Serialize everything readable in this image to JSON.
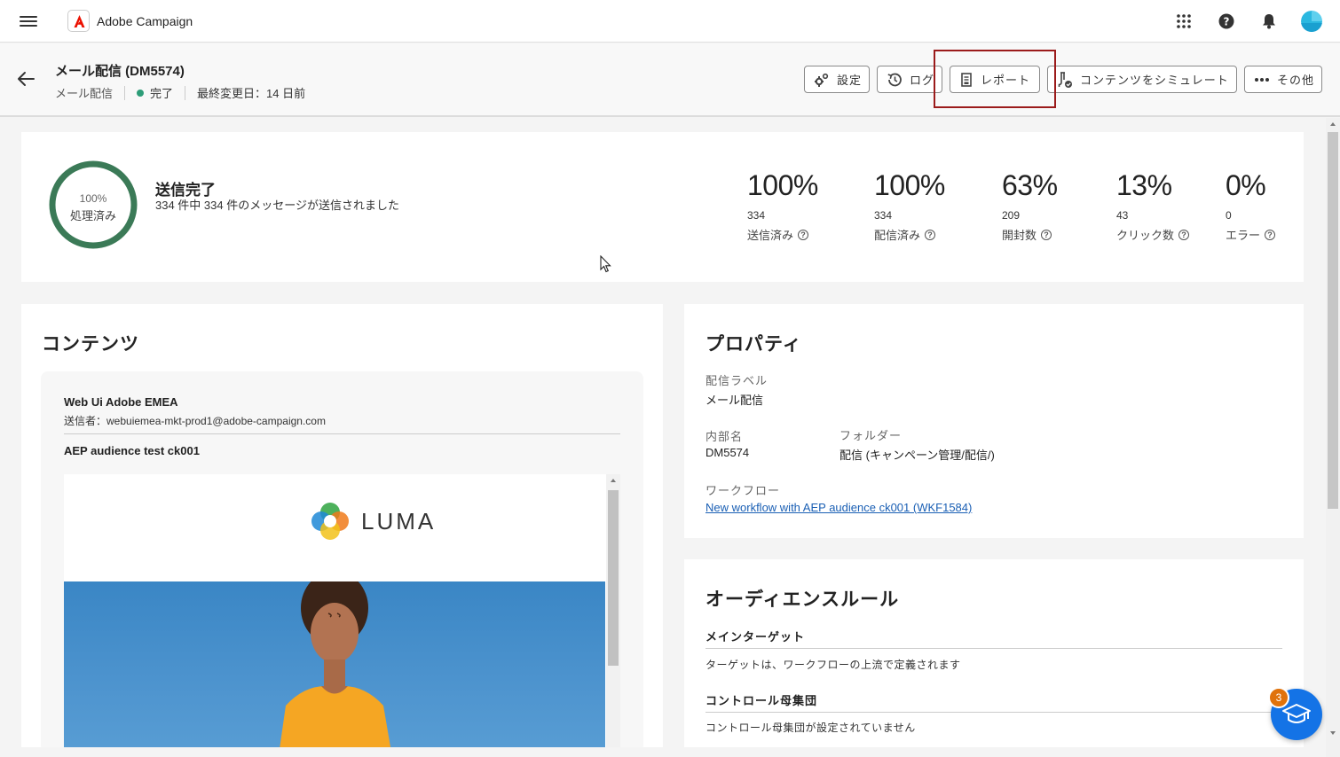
{
  "app": {
    "title": "Adobe Campaign"
  },
  "header": {
    "title": "メール配信 (DM5574)",
    "type": "メール配信",
    "status": "完了",
    "modified": "最終変更日：14 日前"
  },
  "toolbar": {
    "settings": "設定",
    "logs": "ログ",
    "report": "レポート",
    "simulate": "コンテンツをシミュレート",
    "more": "その他"
  },
  "summary": {
    "ring_percent": "100%",
    "ring_label": "処理済み",
    "title": "送信完了",
    "subtitle": "334 件中 334 件のメッセージが送信されました",
    "stats": [
      {
        "percent": "100%",
        "count": "334",
        "label": "送信済み"
      },
      {
        "percent": "100%",
        "count": "334",
        "label": "配信済み"
      },
      {
        "percent": "63%",
        "count": "209",
        "label": "開封数"
      },
      {
        "percent": "13%",
        "count": "43",
        "label": "クリック数"
      },
      {
        "percent": "0%",
        "count": "0",
        "label": "エラー"
      }
    ]
  },
  "content": {
    "title": "コンテンツ",
    "sender_name": "Web Ui Adobe EMEA",
    "sender_email": "送信者：webuiemea-mkt-prod1@adobe-campaign.com",
    "subject": "AEP audience test ck001",
    "brand": "LUMA"
  },
  "properties": {
    "title": "プロパティ",
    "label_label": "配信ラベル",
    "label_value": "メール配信",
    "internal_label": "内部名",
    "internal_value": "DM5574",
    "folder_label": "フォルダー",
    "folder_value": "配信 (キャンペーン管理/配信/)",
    "workflow_label": "ワークフロー",
    "workflow_value": "New workflow with AEP audience ck001 (WKF1584)"
  },
  "audience": {
    "title": "オーディエンスルール",
    "main_target": "メインターゲット",
    "main_target_text": "ターゲットは、ワークフローの上流で定義されます",
    "control": "コントロール母集団",
    "control_text": "コントロール母集団が設定されていません"
  },
  "fab": {
    "badge": "3"
  },
  "colors": {
    "accent": "#1473e6",
    "status_green": "#2d9d78",
    "ring_green": "#3b7a57",
    "highlight": "#9b1b1b",
    "adobe_red": "#eb1000"
  }
}
